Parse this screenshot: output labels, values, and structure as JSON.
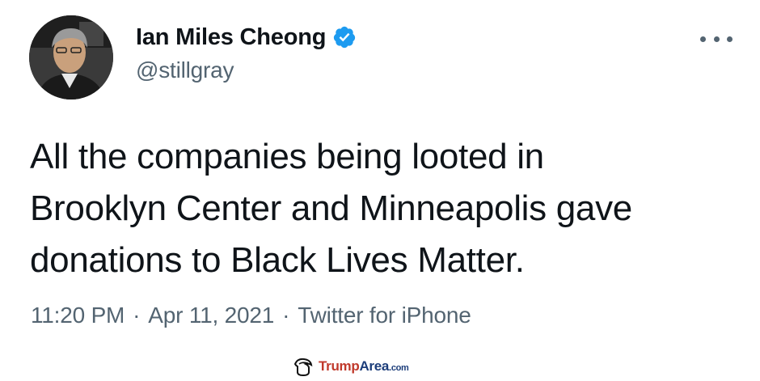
{
  "author": {
    "display_name": "Ian Miles Cheong",
    "handle": "@stillgray",
    "verified": true,
    "verified_color": "#1d9bf0"
  },
  "menu": {
    "icon": "more-horizontal-icon"
  },
  "tweet": {
    "text": "All the companies being looted in\nBrooklyn Center and Minneapolis gave\ndonations to Black Lives Matter."
  },
  "meta": {
    "time": "11:20 PM",
    "separator": "·",
    "date": "Apr 11, 2021",
    "source": "Twitter for iPhone"
  },
  "watermark": {
    "part1": "Trump",
    "part2": "Area",
    "suffix": ".com"
  },
  "colors": {
    "text_primary": "#0f1419",
    "text_secondary": "#536471",
    "watermark_red": "#c0392b",
    "watermark_blue": "#1c3d7a"
  }
}
